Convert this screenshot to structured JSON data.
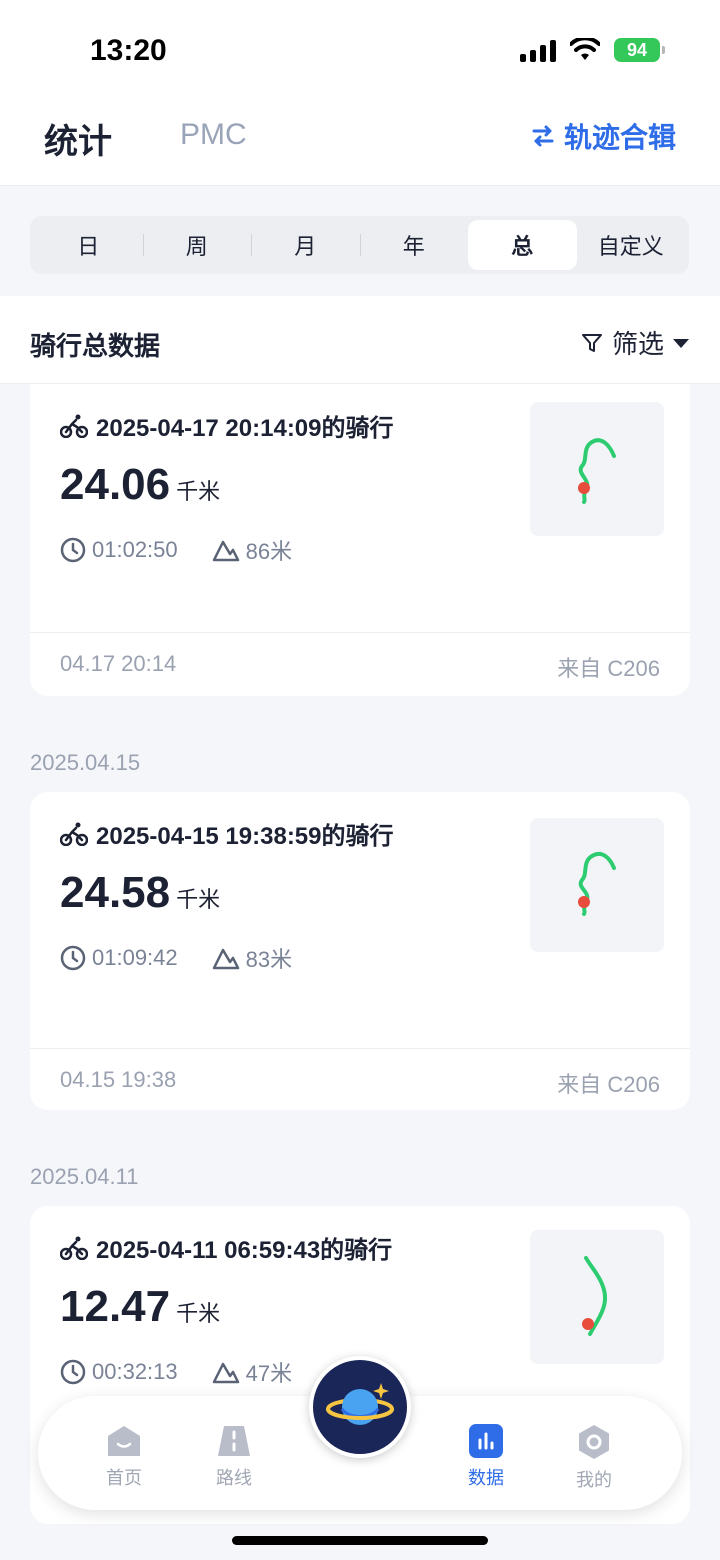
{
  "status": {
    "time": "13:20",
    "battery": "94"
  },
  "header": {
    "tab_stats": "统计",
    "tab_pmc": "PMC",
    "collection_label": "轨迹合辑"
  },
  "periods": [
    "日",
    "周",
    "月",
    "年",
    "总",
    "自定义"
  ],
  "active_period": "总",
  "section": {
    "title": "骑行总数据",
    "filter_label": "筛选"
  },
  "rides": [
    {
      "date_label": "",
      "title": "2025-04-17 20:14:09的骑行",
      "distance": "24.06",
      "unit": "千米",
      "duration": "01:02:50",
      "elevation": "86米",
      "foot_time": "04.17 20:14",
      "source": "来自 C206"
    },
    {
      "date_label": "2025.04.15",
      "title": "2025-04-15 19:38:59的骑行",
      "distance": "24.58",
      "unit": "千米",
      "duration": "01:09:42",
      "elevation": "83米",
      "foot_time": "04.15 19:38",
      "source": "来自 C206"
    },
    {
      "date_label": "2025.04.11",
      "title": "2025-04-11 06:59:43的骑行",
      "distance": "12.47",
      "unit": "千米",
      "duration": "00:32:13",
      "elevation": "47米"
    }
  ],
  "tabbar": {
    "home": "首页",
    "route": "路线",
    "data": "数据",
    "mine": "我的"
  },
  "colors": {
    "accent": "#2f6de8",
    "track": "#2ecc71",
    "marker": "#e74c3c"
  }
}
